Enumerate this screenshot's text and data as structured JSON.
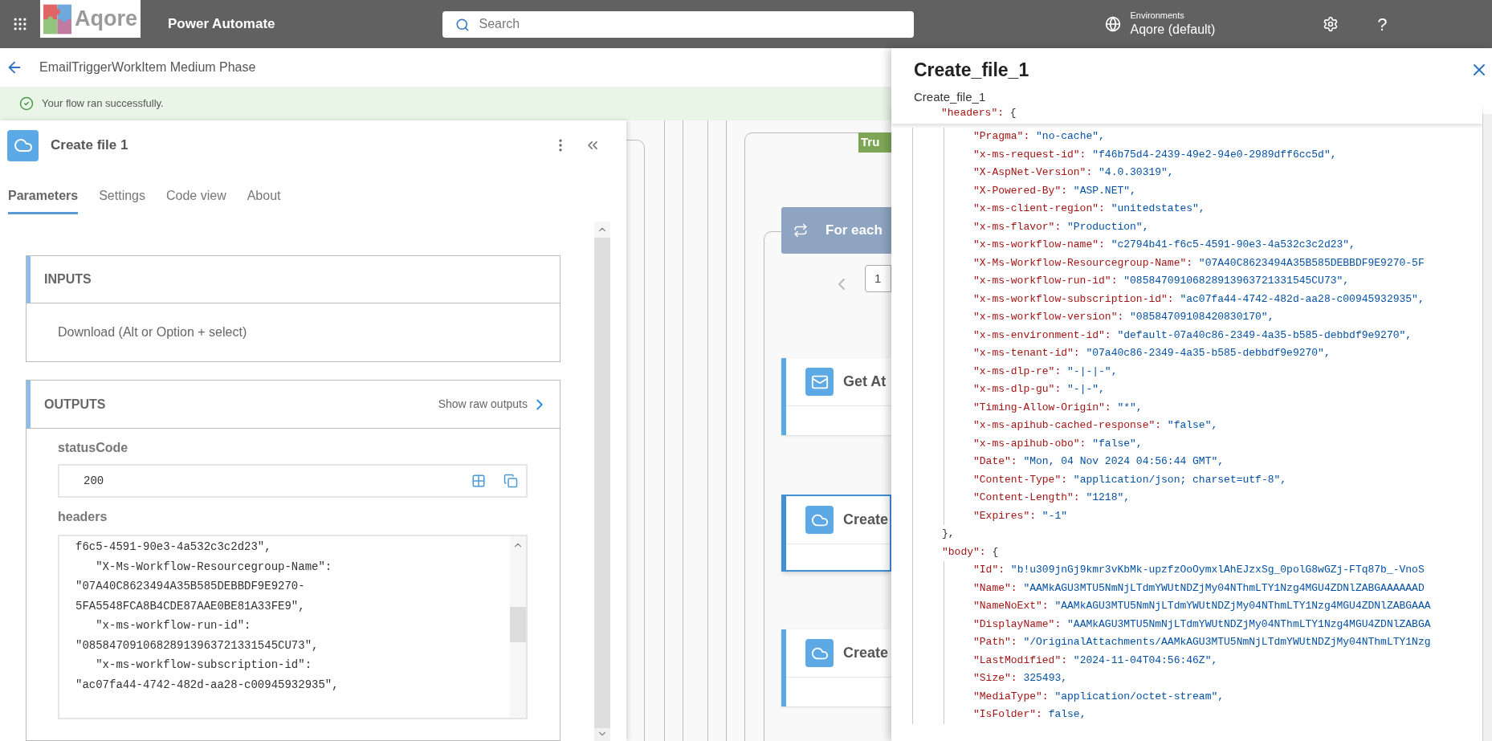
{
  "top_bar": {
    "logo_text": "Aqore",
    "app_name": "Power Automate",
    "search": {
      "placeholder": "Search"
    },
    "environment": {
      "label": "Environments",
      "value": "Aqore (default)"
    },
    "help": "?"
  },
  "flow_bar": {
    "title": "EmailTriggerWorkItem Medium Phase"
  },
  "banner": {
    "message": "Your flow ran successfully."
  },
  "action_panel": {
    "title": "Create file 1",
    "tabs": [
      {
        "label": "Parameters",
        "selected": true
      },
      {
        "label": "Settings",
        "selected": false
      },
      {
        "label": "Code view",
        "selected": false
      },
      {
        "label": "About",
        "selected": false
      }
    ],
    "sections": [
      {
        "kind": "inputs",
        "heading": "INPUTS",
        "link": "Download (Alt or Option + select)"
      },
      {
        "kind": "outputs",
        "heading": "OUTPUTS",
        "raw_link": "Show raw outputs",
        "fields": [
          {
            "kind": "value",
            "label": "statusCode",
            "value": "200"
          },
          {
            "kind": "code",
            "label": "headers",
            "lines": [
              "f6c5-4591-90e3-4a532c3c2d23\",",
              "   \"X-Ms-Workflow-Resourcegroup-Name\":",
              "\"07A40C8623494A35B585DEBBDF9E9270-",
              "5FA5548FCA8B4CDE87AAE0BE81A33FE9\",",
              "   \"x-ms-workflow-run-id\":",
              "\"08584709106828913963721331545CU73\",",
              "   \"x-ms-workflow-subscription-id\":",
              "\"ac07fa44-4742-482d-aa28-c00945932935\","
            ]
          }
        ]
      }
    ]
  },
  "canvas": {
    "condition_badge": "Tru",
    "loop": {
      "title": "For each",
      "page": "1"
    },
    "actions": [
      {
        "title": "Get At",
        "selected": false
      },
      {
        "title": "Create",
        "selected": true
      },
      {
        "title": "Create",
        "selected": false
      }
    ]
  },
  "details_panel": {
    "title": "Create_file_1",
    "subtitle": "Create_file_1",
    "code": [
      {
        "kind": "open",
        "key": "\"headers\":",
        "value": "{",
        "children": [
          {
            "kind": "pair",
            "key": "\"Pragma\":",
            "value": "\"no-cache\","
          },
          {
            "kind": "pair",
            "key": "\"x-ms-request-id\":",
            "value": "\"f46b75d4-2439-49e2-94e0-2989dff6cc5d\","
          },
          {
            "kind": "pair",
            "key": "\"X-AspNet-Version\":",
            "value": "\"4.0.30319\","
          },
          {
            "kind": "pair",
            "key": "\"X-Powered-By\":",
            "value": "\"ASP.NET\","
          },
          {
            "kind": "pair",
            "key": "\"x-ms-client-region\":",
            "value": "\"unitedstates\","
          },
          {
            "kind": "pair",
            "key": "\"x-ms-flavor\":",
            "value": "\"Production\","
          },
          {
            "kind": "pair",
            "key": "\"x-ms-workflow-name\":",
            "value": "\"c2794b41-f6c5-4591-90e3-4a532c3c2d23\","
          },
          {
            "kind": "pair",
            "key": "\"X-Ms-Workflow-Resourcegroup-Name\":",
            "value": "\"07A40C8623494A35B585DEBBDF9E9270-5F"
          },
          {
            "kind": "pair",
            "key": "\"x-ms-workflow-run-id\":",
            "value": "\"08584709106828913963721331545CU73\","
          },
          {
            "kind": "pair",
            "key": "\"x-ms-workflow-subscription-id\":",
            "value": "\"ac07fa44-4742-482d-aa28-c00945932935\","
          },
          {
            "kind": "pair",
            "key": "\"x-ms-workflow-version\":",
            "value": "\"08584709108420830170\","
          },
          {
            "kind": "pair",
            "key": "\"x-ms-environment-id\":",
            "value": "\"default-07a40c86-2349-4a35-b585-debbdf9e9270\","
          },
          {
            "kind": "pair",
            "key": "\"x-ms-tenant-id\":",
            "value": "\"07a40c86-2349-4a35-b585-debbdf9e9270\","
          },
          {
            "kind": "pair",
            "key": "\"x-ms-dlp-re\":",
            "value": "\"-|-|-\","
          },
          {
            "kind": "pair",
            "key": "\"x-ms-dlp-gu\":",
            "value": "\"-|-\","
          },
          {
            "kind": "pair",
            "key": "\"Timing-Allow-Origin\":",
            "value": "\"*\","
          },
          {
            "kind": "pair",
            "key": "\"x-ms-apihub-cached-response\":",
            "value": "\"false\","
          },
          {
            "kind": "pair",
            "key": "\"x-ms-apihub-obo\":",
            "value": "\"false\","
          },
          {
            "kind": "pair",
            "key": "\"Date\":",
            "value": "\"Mon, 04 Nov 2024 04:56:44 GMT\","
          },
          {
            "kind": "pair",
            "key": "\"Content-Type\":",
            "value": "\"application/json; charset=utf-8\","
          },
          {
            "kind": "pair",
            "key": "\"Content-Length\":",
            "value": "\"1218\","
          },
          {
            "kind": "pair",
            "key": "\"Expires\":",
            "value": "\"-1\""
          }
        ]
      },
      {
        "kind": "close",
        "value": "},"
      },
      {
        "kind": "open",
        "key": "\"body\":",
        "value": "{",
        "children": [
          {
            "kind": "pair",
            "key": "\"Id\":",
            "value": "\"b!u309jnGj9kmr3vKbMk-upzfzOoOymxlAhEJzxSg_0polG8wGZj-FTq87b_-VnoS"
          },
          {
            "kind": "pair",
            "key": "\"Name\":",
            "value": "\"AAMkAGU3MTU5NmNjLTdmYWUtNDZjMy04NThmLTY1Nzg4MGU4ZDNlZABGAAAAAAD"
          },
          {
            "kind": "pair",
            "key": "\"NameNoExt\":",
            "value": "\"AAMkAGU3MTU5NmNjLTdmYWUtNDZjMy04NThmLTY1Nzg4MGU4ZDNlZABGAAA"
          },
          {
            "kind": "pair",
            "key": "\"DisplayName\":",
            "value": "\"AAMkAGU3MTU5NmNjLTdmYWUtNDZjMy04NThmLTY1Nzg4MGU4ZDNlZABGA"
          },
          {
            "kind": "pair",
            "key": "\"Path\":",
            "value": "\"/OriginalAttachments/AAMkAGU3MTU5NmNjLTdmYWUtNDZjMy04NThmLTY1Nzg"
          },
          {
            "kind": "pair",
            "key": "\"LastModified\":",
            "value": "\"2024-11-04T04:56:46Z\","
          },
          {
            "kind": "pair",
            "key": "\"Size\":",
            "value": "325493,"
          },
          {
            "kind": "pair",
            "key": "\"MediaType\":",
            "value": "\"application/octet-stream\","
          },
          {
            "kind": "pair",
            "key": "\"IsFolder\":",
            "value": "false,"
          }
        ]
      }
    ]
  }
}
